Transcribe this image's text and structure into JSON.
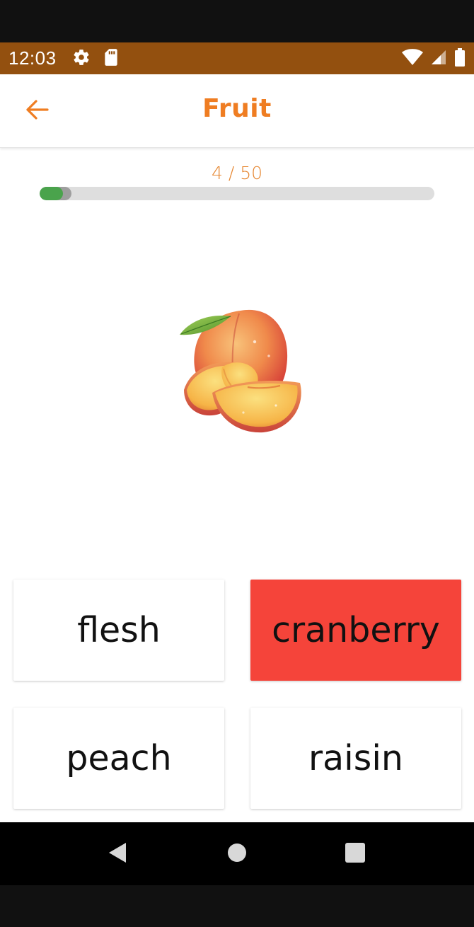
{
  "status_bar": {
    "time": "12:03",
    "icons": [
      "settings-icon",
      "sd-card-icon",
      "wifi-icon",
      "signal-icon",
      "battery-icon"
    ],
    "background": "#93500f"
  },
  "appbar": {
    "title": "Fruit",
    "back_icon": "arrow-left-icon",
    "accent": "#ef7d22"
  },
  "progress": {
    "label": "4 / 50",
    "current": 4,
    "total": 50,
    "fill_color": "#4aa34c"
  },
  "question": {
    "image": "peach-image"
  },
  "options": [
    {
      "label": "flesh",
      "state": "default"
    },
    {
      "label": "cranberry",
      "state": "wrong"
    },
    {
      "label": "peach",
      "state": "default"
    },
    {
      "label": "raisin",
      "state": "default"
    }
  ],
  "colors": {
    "wrong": "#f5443a"
  },
  "nav_bar": {
    "icons": [
      "back-triangle-icon",
      "home-circle-icon",
      "recents-square-icon"
    ]
  }
}
